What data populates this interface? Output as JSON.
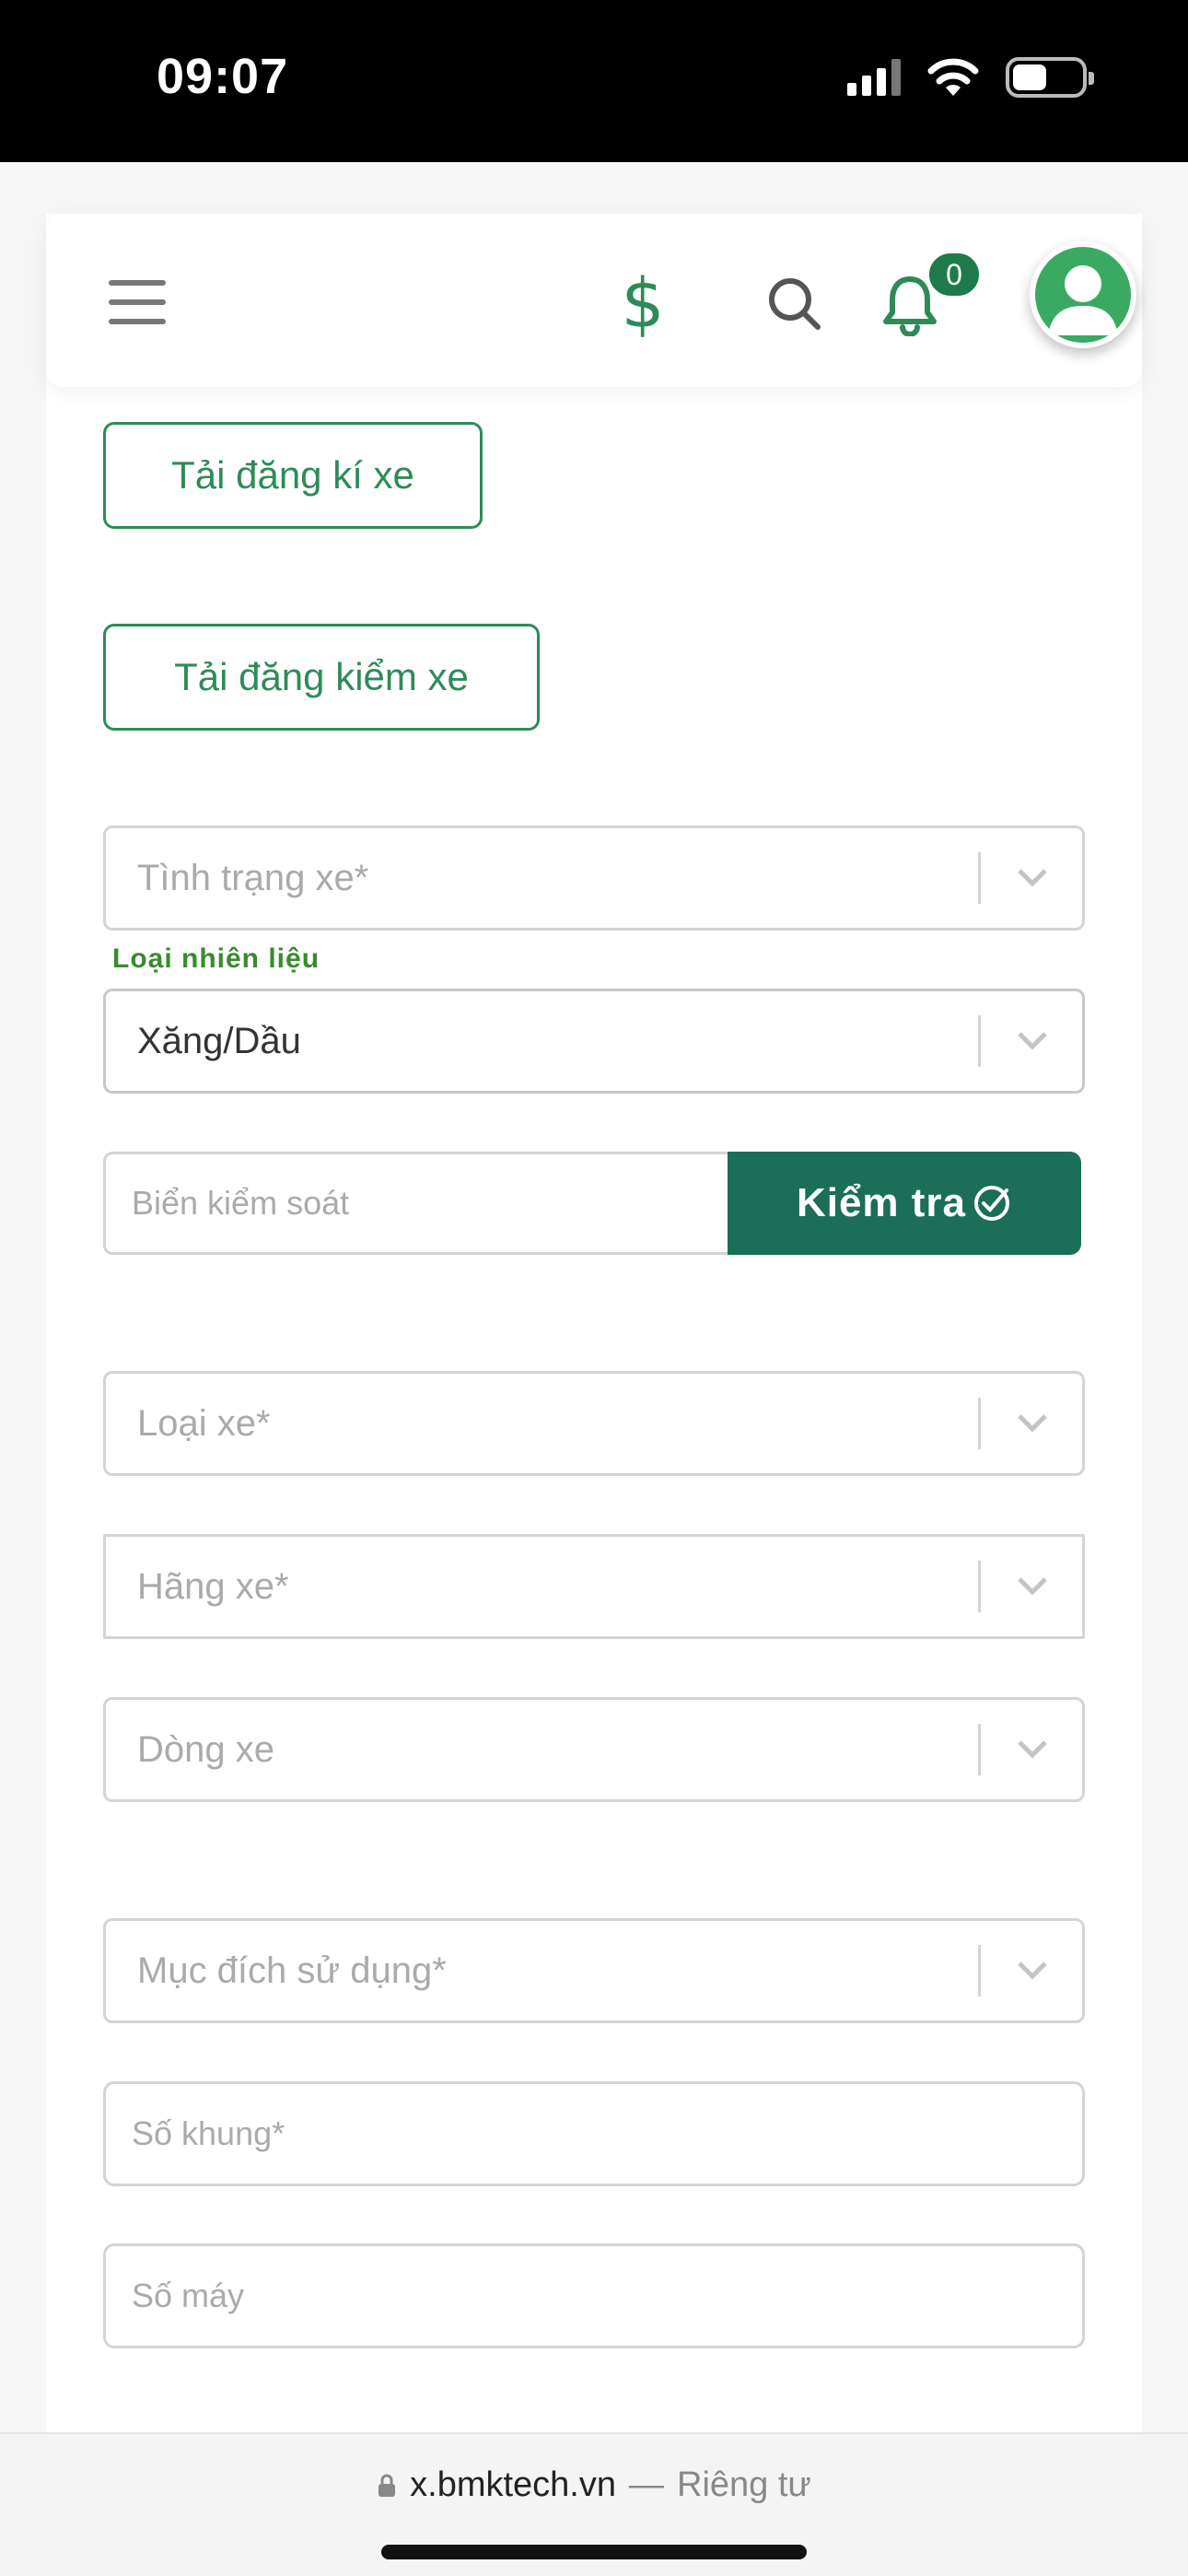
{
  "status_bar": {
    "time": "09:07",
    "icons": [
      "cellular-signal-icon",
      "wifi-icon",
      "battery-icon"
    ]
  },
  "header": {
    "icons": [
      "menu-icon",
      "dollar-icon",
      "search-icon",
      "bell-icon",
      "avatar-icon"
    ],
    "notification_count": "0",
    "accent_color": "#2e8b57"
  },
  "buttons": {
    "upload_registration": "Tải đăng kí xe",
    "upload_inspection": "Tải đăng kiểm xe",
    "check": "Kiểm tra"
  },
  "form": {
    "vehicle_condition": {
      "placeholder": "Tình trạng xe*"
    },
    "fuel_type": {
      "label": "Loại nhiên liệu",
      "value": "Xăng/Dầu"
    },
    "license_plate": {
      "placeholder": "Biển kiểm soát"
    },
    "vehicle_type": {
      "placeholder": "Loại xe*"
    },
    "vehicle_brand": {
      "placeholder": "Hãng xe*"
    },
    "vehicle_model": {
      "placeholder": "Dòng xe"
    },
    "usage_purpose": {
      "placeholder": "Mục đích sử dụng*"
    },
    "chassis_number": {
      "placeholder": "Số khung*"
    },
    "engine_number": {
      "placeholder": "Số máy"
    }
  },
  "browser": {
    "domain": "x.bmktech.vn",
    "separator": "—",
    "privacy": "Riêng tư"
  },
  "colors": {
    "primary_green": "#2e8b57",
    "check_button": "#1b6e57",
    "label_green": "#3a8a2e"
  }
}
